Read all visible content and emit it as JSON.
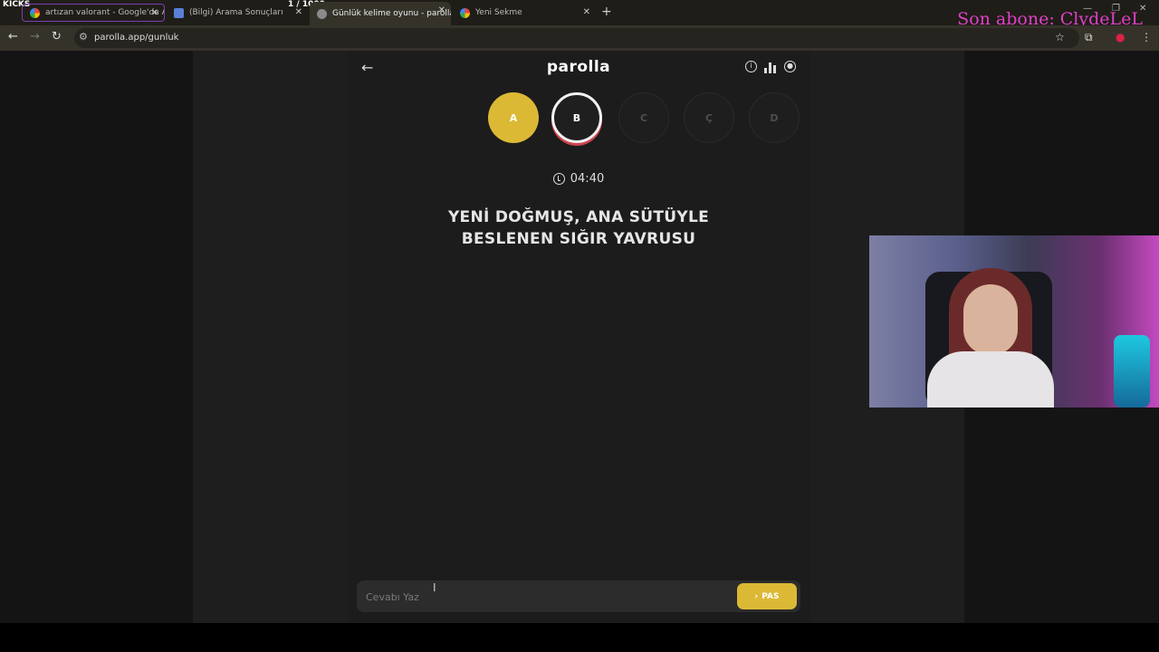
{
  "stream_overlay": {
    "platform_label": "KICKS",
    "counter": "1  / 1000",
    "last_subscriber": "Son abone: ClydeLeL"
  },
  "browser": {
    "tabs": [
      {
        "title": "artızan valorant - Google'da A",
        "active": false
      },
      {
        "title": "(Bilgi) Arama Sonuçları",
        "active": false
      },
      {
        "title": "Günlük kelime oyunu - parolla",
        "active": true
      },
      {
        "title": "Yeni Sekme",
        "active": false
      }
    ],
    "new_tab": "+",
    "url": "parolla.app/gunluk"
  },
  "app": {
    "logo": "parolla",
    "letters": [
      {
        "label": "A",
        "state": "done"
      },
      {
        "label": "B",
        "state": "active"
      },
      {
        "label": "C",
        "state": "pending"
      },
      {
        "label": "Ç",
        "state": "pending"
      },
      {
        "label": "D",
        "state": "pending"
      }
    ],
    "timer": "04:40",
    "question_line1": "YENİ DOĞMUŞ, ANA SÜTÜYLE",
    "question_line2": "BESLENEN SIĞIR YAVRUSU",
    "answer_placeholder": "Cevabı Yaz",
    "pass_label": "PAS"
  },
  "colors": {
    "accent_gold": "#dcb935",
    "active_ring_red": "#d0454f",
    "subscriber_pink": "#e040c8"
  },
  "icons": [
    "back-arrow-icon",
    "info-icon",
    "stats-icon",
    "user-icon",
    "clock-icon",
    "chevron-right-icon"
  ]
}
